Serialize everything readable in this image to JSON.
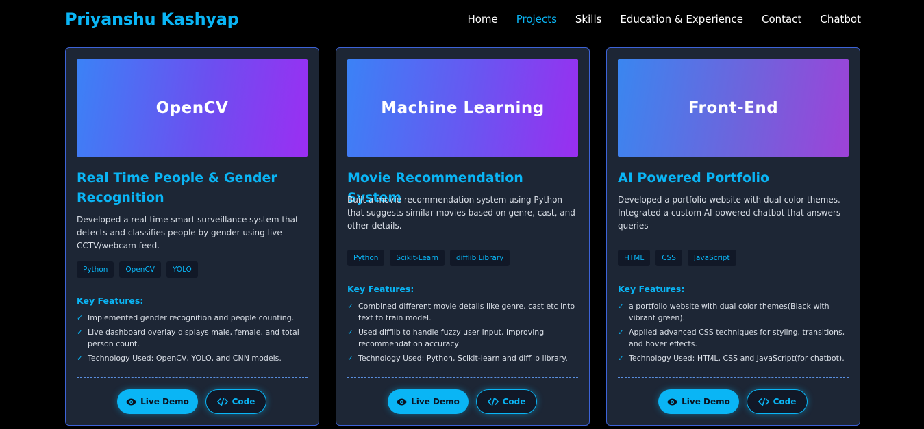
{
  "header": {
    "brand": "Priyanshu Kashyap",
    "nav": [
      {
        "label": "Home",
        "active": false
      },
      {
        "label": "Projects",
        "active": true
      },
      {
        "label": "Skills",
        "active": false
      },
      {
        "label": "Education & Experience",
        "active": false
      },
      {
        "label": "Contact",
        "active": false
      },
      {
        "label": "Chatbot",
        "active": false
      }
    ]
  },
  "colors": {
    "accent": "#0ab5f5",
    "background": "#000000",
    "card": "#1d2635",
    "card_border": "#3d63d8"
  },
  "projects": [
    {
      "banner": "OpenCV",
      "title": "Real Time People & Gender Recognition",
      "description": "Developed a real-time smart surveillance system that detects and classifies people by gender using live CCTV/webcam feed.",
      "tags": [
        "Python",
        "OpenCV",
        "YOLO"
      ],
      "features_title": "Key Features:",
      "features": [
        "Implemented gender recognition and people counting.",
        "Live dashboard overlay displays male, female, and total person count.",
        "Technology Used: OpenCV, YOLO, and CNN models."
      ],
      "demo_label": "Live Demo",
      "code_label": "Code"
    },
    {
      "banner": "Machine Learning",
      "title": "Movie Recommendation System",
      "description": "Built a movie recommendation system using Python that suggests similar movies based on genre, cast, and other details.",
      "tags": [
        "Python",
        "Scikit-Learn",
        "difflib Library"
      ],
      "features_title": "Key Features:",
      "features": [
        "Combined different movie details like genre, cast etc into text to train model.",
        "Used difflib to handle fuzzy user input, improving recommendation accuracy",
        "Technology Used: Python, Scikit-learn and difflib library."
      ],
      "demo_label": "Live Demo",
      "code_label": "Code"
    },
    {
      "banner": "Front-End",
      "title": "AI Powered Portfolio",
      "description": "Developed a portfolio website with dual color themes. Integrated a custom AI-powered chatbot that answers queries",
      "tags": [
        "HTML",
        "CSS",
        "JavaScript"
      ],
      "features_title": "Key Features:",
      "features": [
        "a portfolio website with dual color themes(Black with vibrant green).",
        "Applied advanced CSS techniques for styling, transitions, and hover effects.",
        "Technology Used: HTML, CSS and JavaScript(for chatbot)."
      ],
      "demo_label": "Live Demo",
      "code_label": "Code"
    }
  ]
}
